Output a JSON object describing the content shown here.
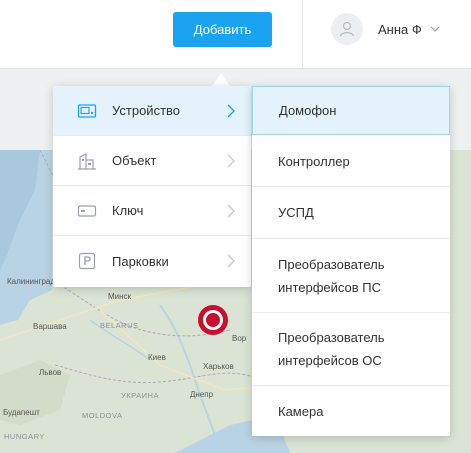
{
  "header": {
    "add_button_label": "Добавить",
    "user_name": "Анна Ф",
    "avatar_icon": "user-avatar-icon",
    "dropdown_icon": "chevron-down-icon"
  },
  "menu": {
    "categories": [
      {
        "label": "Устройство",
        "icon": "device-icon",
        "active": true
      },
      {
        "label": "Объект",
        "icon": "building-icon",
        "active": false
      },
      {
        "label": "Ключ",
        "icon": "key-card-icon",
        "active": false
      },
      {
        "label": "Парковки",
        "icon": "parking-icon",
        "active": false
      }
    ],
    "device_types": [
      {
        "label": "Домофон",
        "active": true
      },
      {
        "label": "Контроллер",
        "active": false
      },
      {
        "label": "УСПД",
        "active": false
      },
      {
        "label": "Преобразователь интерфейсов ПС",
        "active": false
      },
      {
        "label": "Преобразователь интерфейсов ОС",
        "active": false
      },
      {
        "label": "Камера",
        "active": false
      }
    ]
  },
  "map": {
    "labels": {
      "minsk": "Минск",
      "belarus": "BELARUS",
      "warsaw": "Варшава",
      "kaliningrad": "Калининград",
      "kyiv": "Киев",
      "kharkiv": "Харьков",
      "lviv": "Львов",
      "ukraine": "УКРАИНА",
      "dnipro": "Днепр",
      "moldova": "MOLDOVA",
      "budapest": "Будапешт",
      "vor": "Вор",
      "hungary": "HUNGARY"
    }
  },
  "colors": {
    "accent": "#1aa3f0",
    "active_bg": "#e4f3fb",
    "marker": "#c8102e"
  }
}
